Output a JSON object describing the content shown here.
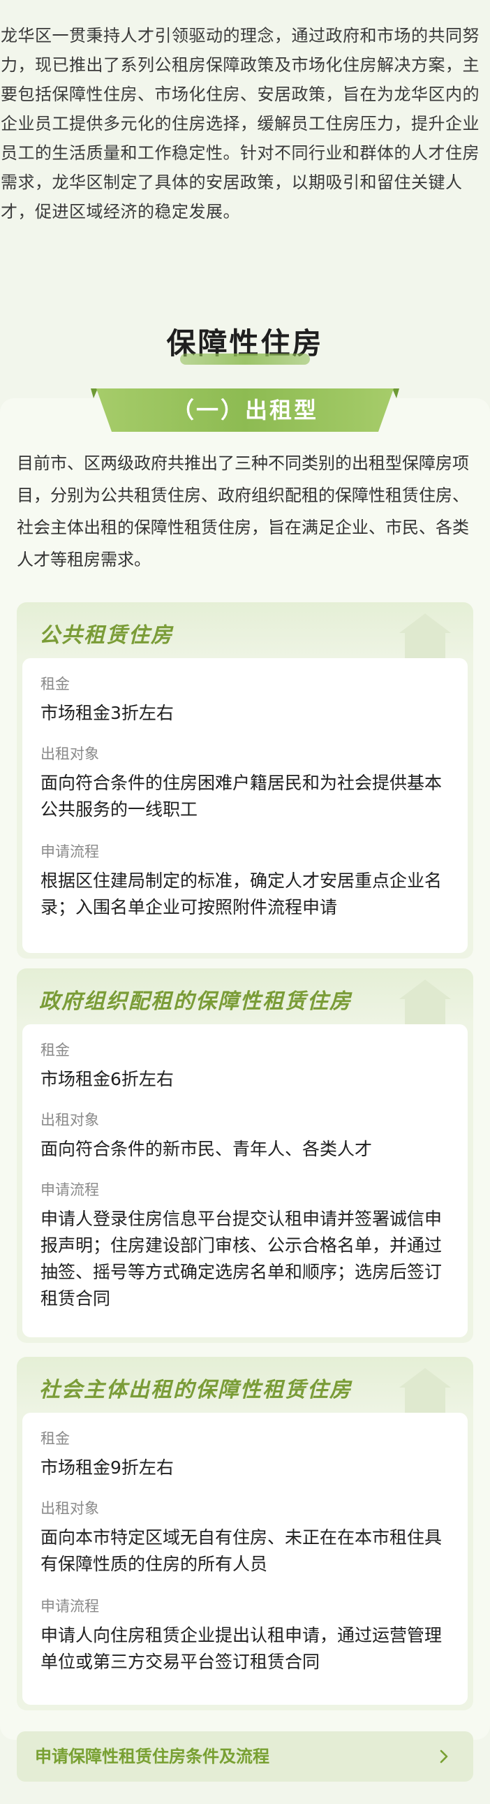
{
  "intro": "龙华区一贯秉持人才引领驱动的理念，通过政府和市场的共同努力，现已推出了系列公租房保障政策及市场化住房解决方案，主要包括保障性住房、市场化住房、安居政策，旨在为龙华区内的企业员工提供多元化的住房选择，缓解员工住房压力，提升企业员工的生活质量和工作稳定性。针对不同行业和群体的人才住房需求，龙华区制定了具体的安居政策，以期吸引和留住关键人才，促进区域经济的稳定发展。",
  "section_title": "保障性住房",
  "subsection_label": "（一）出租型",
  "description": "目前市、区两级政府共推出了三种不同类别的出租型保障房项目，分别为公共租赁住房、政府组织配租的保障性租赁住房、社会主体出租的保障性租赁住房，旨在满足企业、市民、各类人才等租房需求。",
  "cards": [
    {
      "title": "公共租赁住房",
      "fields": [
        {
          "label": "租金",
          "value": "市场租金3折左右"
        },
        {
          "label": "出租对象",
          "value": "面向符合条件的住房困难户籍居民和为社会提供基本公共服务的一线职工"
        },
        {
          "label": "申请流程",
          "value": "根据区住建局制定的标准，确定人才安居重点企业名录；入围名单企业可按照附件流程申请"
        }
      ]
    },
    {
      "title": "政府组织配租的保障性租赁住房",
      "fields": [
        {
          "label": "租金",
          "value": "市场租金6折左右"
        },
        {
          "label": "出租对象",
          "value": "面向符合条件的新市民、青年人、各类人才"
        },
        {
          "label": "申请流程",
          "value": "申请人登录住房信息平台提交认租申请并签署诚信申报声明；住房建设部门审核、公示合格名单，并通过抽签、摇号等方式确定选房名单和顺序；选房后签订租赁合同"
        }
      ]
    },
    {
      "title": "社会主体出租的保障性租赁住房",
      "fields": [
        {
          "label": "租金",
          "value": "市场租金9折左右"
        },
        {
          "label": "出租对象",
          "value": "面向本市特定区域无自有住房、未正在在本市租住具有保障性质的住房的所有人员"
        },
        {
          "label": "申请流程",
          "value": "申请人向住房租赁企业提出认租申请，通过运营管理单位或第三方交易平台签订租赁合同"
        }
      ]
    }
  ],
  "apply_link": "申请保障性租赁住房条件及流程",
  "colors": {
    "accent": "#7a9c37",
    "ribbon": "#8dbb52",
    "background": "#f2f6ec"
  },
  "icons": {
    "card_decoration": "house-icon",
    "link_arrow": "chevron-right-icon"
  }
}
